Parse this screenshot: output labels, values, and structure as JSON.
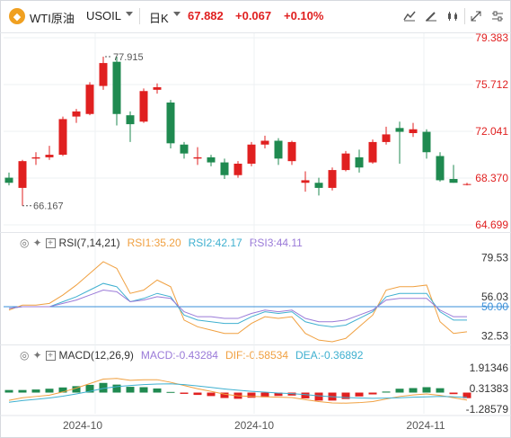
{
  "header": {
    "symbol_icon": "oil-icon",
    "symbol_name": "WTI原油",
    "symbol_code": "USOIL",
    "period": "日K",
    "price": "67.882",
    "change": "+0.067",
    "change_pct": "+0.10%",
    "tools": [
      "line-chart-icon",
      "pen-icon",
      "candle-style-icon",
      "expand-icon",
      "settings-icon"
    ]
  },
  "colors": {
    "up": "#e02020",
    "down": "#1f8a50",
    "rsi1": "#f0a040",
    "rsi2": "#3fb0d0",
    "rsi3": "#9a7ad8",
    "macd_dif": "#f0a040",
    "macd_dea": "#3fb0d0",
    "price_axis": "#e02020",
    "neutral": "#333333"
  },
  "chart_data": [
    {
      "type": "candlestick",
      "yaxis_ticks": [
        "79.383",
        "75.712",
        "72.041",
        "68.370",
        "64.699"
      ],
      "ylim": [
        64.699,
        79.383
      ],
      "annotations": {
        "high_label": "77.915",
        "low_label": "66.167"
      },
      "candles": [
        {
          "o": 68.4,
          "h": 68.8,
          "l": 67.8,
          "c": 68.0
        },
        {
          "o": 67.6,
          "h": 69.8,
          "l": 66.2,
          "c": 69.7
        },
        {
          "o": 69.9,
          "h": 70.4,
          "l": 69.4,
          "c": 70.0
        },
        {
          "o": 70.0,
          "h": 70.9,
          "l": 69.8,
          "c": 70.2
        },
        {
          "o": 70.2,
          "h": 73.2,
          "l": 70.1,
          "c": 73.0
        },
        {
          "o": 73.2,
          "h": 73.8,
          "l": 72.7,
          "c": 73.6
        },
        {
          "o": 73.4,
          "h": 75.9,
          "l": 73.3,
          "c": 75.7
        },
        {
          "o": 75.6,
          "h": 77.9,
          "l": 75.3,
          "c": 77.4
        },
        {
          "o": 77.5,
          "h": 77.9,
          "l": 72.5,
          "c": 73.4
        },
        {
          "o": 73.3,
          "h": 73.6,
          "l": 71.2,
          "c": 72.6
        },
        {
          "o": 72.8,
          "h": 75.4,
          "l": 72.7,
          "c": 75.2
        },
        {
          "o": 75.3,
          "h": 75.8,
          "l": 75.0,
          "c": 75.5
        },
        {
          "o": 74.3,
          "h": 74.5,
          "l": 70.7,
          "c": 71.1
        },
        {
          "o": 71.0,
          "h": 71.2,
          "l": 69.9,
          "c": 70.3
        },
        {
          "o": 69.9,
          "h": 70.8,
          "l": 69.4,
          "c": 70.0
        },
        {
          "o": 70.0,
          "h": 70.2,
          "l": 69.3,
          "c": 69.6
        },
        {
          "o": 69.6,
          "h": 69.9,
          "l": 68.3,
          "c": 68.6
        },
        {
          "o": 68.6,
          "h": 69.7,
          "l": 68.4,
          "c": 69.5
        },
        {
          "o": 69.5,
          "h": 71.2,
          "l": 69.3,
          "c": 71.0
        },
        {
          "o": 71.0,
          "h": 71.7,
          "l": 70.7,
          "c": 71.3
        },
        {
          "o": 71.3,
          "h": 71.5,
          "l": 69.4,
          "c": 69.9
        },
        {
          "o": 69.7,
          "h": 71.3,
          "l": 69.4,
          "c": 71.2
        },
        {
          "o": 68.0,
          "h": 68.9,
          "l": 67.3,
          "c": 68.2
        },
        {
          "o": 68.0,
          "h": 68.4,
          "l": 67.0,
          "c": 67.6
        },
        {
          "o": 67.6,
          "h": 69.2,
          "l": 67.4,
          "c": 69.0
        },
        {
          "o": 69.0,
          "h": 70.5,
          "l": 68.9,
          "c": 70.3
        },
        {
          "o": 70.0,
          "h": 70.6,
          "l": 68.8,
          "c": 69.2
        },
        {
          "o": 69.6,
          "h": 71.4,
          "l": 69.5,
          "c": 71.2
        },
        {
          "o": 71.2,
          "h": 72.4,
          "l": 71.0,
          "c": 71.8
        },
        {
          "o": 72.3,
          "h": 72.8,
          "l": 69.5,
          "c": 72.0
        },
        {
          "o": 71.9,
          "h": 72.7,
          "l": 71.6,
          "c": 72.2
        },
        {
          "o": 72.0,
          "h": 72.2,
          "l": 69.9,
          "c": 70.4
        },
        {
          "o": 70.1,
          "h": 70.4,
          "l": 68.1,
          "c": 68.2
        },
        {
          "o": 68.3,
          "h": 69.4,
          "l": 68.0,
          "c": 68.0
        },
        {
          "o": 67.9,
          "h": 68.0,
          "l": 67.8,
          "c": 67.9
        }
      ]
    },
    {
      "type": "line",
      "indicator": "RSI",
      "legend_label": "RSI(7,14,21)",
      "series": [
        {
          "name": "RSI1:35.20",
          "values": [
            48,
            51,
            51,
            52,
            57,
            63,
            70,
            77,
            73,
            58,
            60,
            66,
            62,
            42,
            38,
            36,
            34,
            34,
            40,
            44,
            43,
            44,
            34,
            30,
            29,
            31,
            38,
            45,
            60,
            62,
            62,
            63,
            41,
            34,
            35
          ]
        },
        {
          "name": "RSI2:42.17",
          "values": [
            49,
            50,
            50,
            50,
            53,
            56,
            60,
            64,
            62,
            53,
            55,
            58,
            56,
            45,
            42,
            41,
            40,
            40,
            44,
            47,
            46,
            47,
            41,
            39,
            38,
            39,
            43,
            47,
            56,
            58,
            58,
            58,
            47,
            42,
            42
          ]
        },
        {
          "name": "RSI3:44.11",
          "values": [
            49,
            50,
            50,
            50,
            52,
            54,
            57,
            60,
            59,
            53,
            54,
            56,
            55,
            47,
            44,
            44,
            43,
            43,
            46,
            48,
            47,
            48,
            43,
            41,
            41,
            42,
            45,
            48,
            54,
            55,
            55,
            55,
            48,
            44,
            44
          ]
        }
      ],
      "reference_line": "50.00",
      "yaxis_ticks": [
        "79.53",
        "56.03",
        "32.53"
      ],
      "ylim": [
        29,
        84
      ]
    },
    {
      "type": "bar",
      "indicator": "MACD",
      "legend_label": "MACD(12,26,9)",
      "series": [
        {
          "name": "MACD:-0.43284",
          "values": [
            0.2,
            0.2,
            0.24,
            0.3,
            0.4,
            0.5,
            0.6,
            0.75,
            0.62,
            0.45,
            0.42,
            0.32,
            0.05,
            -0.1,
            -0.18,
            -0.27,
            -0.42,
            -0.48,
            -0.4,
            -0.36,
            -0.26,
            -0.23,
            -0.45,
            -0.62,
            -0.62,
            -0.5,
            -0.3,
            -0.14,
            0.08,
            0.3,
            0.35,
            0.42,
            0.34,
            -0.12,
            -0.43
          ]
        },
        {
          "name": "DIF:-0.58534",
          "values": [
            -0.6,
            -0.4,
            -0.3,
            -0.2,
            0.05,
            0.35,
            0.7,
            1.05,
            1.1,
            0.95,
            1.0,
            1.0,
            0.8,
            0.55,
            0.3,
            0.1,
            -0.12,
            -0.25,
            -0.3,
            -0.32,
            -0.36,
            -0.38,
            -0.55,
            -0.7,
            -0.8,
            -0.82,
            -0.78,
            -0.7,
            -0.5,
            -0.3,
            -0.18,
            -0.1,
            -0.22,
            -0.4,
            -0.58
          ]
        },
        {
          "name": "DEA:-0.36892",
          "values": [
            -0.75,
            -0.62,
            -0.52,
            -0.42,
            -0.28,
            -0.1,
            0.1,
            0.32,
            0.46,
            0.55,
            0.62,
            0.66,
            0.68,
            0.62,
            0.52,
            0.4,
            0.28,
            0.18,
            0.1,
            0.04,
            -0.03,
            -0.08,
            -0.16,
            -0.25,
            -0.32,
            -0.38,
            -0.42,
            -0.44,
            -0.43,
            -0.4,
            -0.36,
            -0.33,
            -0.3,
            -0.32,
            -0.37
          ]
        }
      ],
      "yaxis_ticks": [
        "1.91346",
        "0.31383",
        "-1.28579"
      ],
      "ylim": [
        -1.5,
        2.2
      ]
    }
  ],
  "xaxis_labels": [
    "2024-10",
    "2024-10",
    "2024-11"
  ]
}
